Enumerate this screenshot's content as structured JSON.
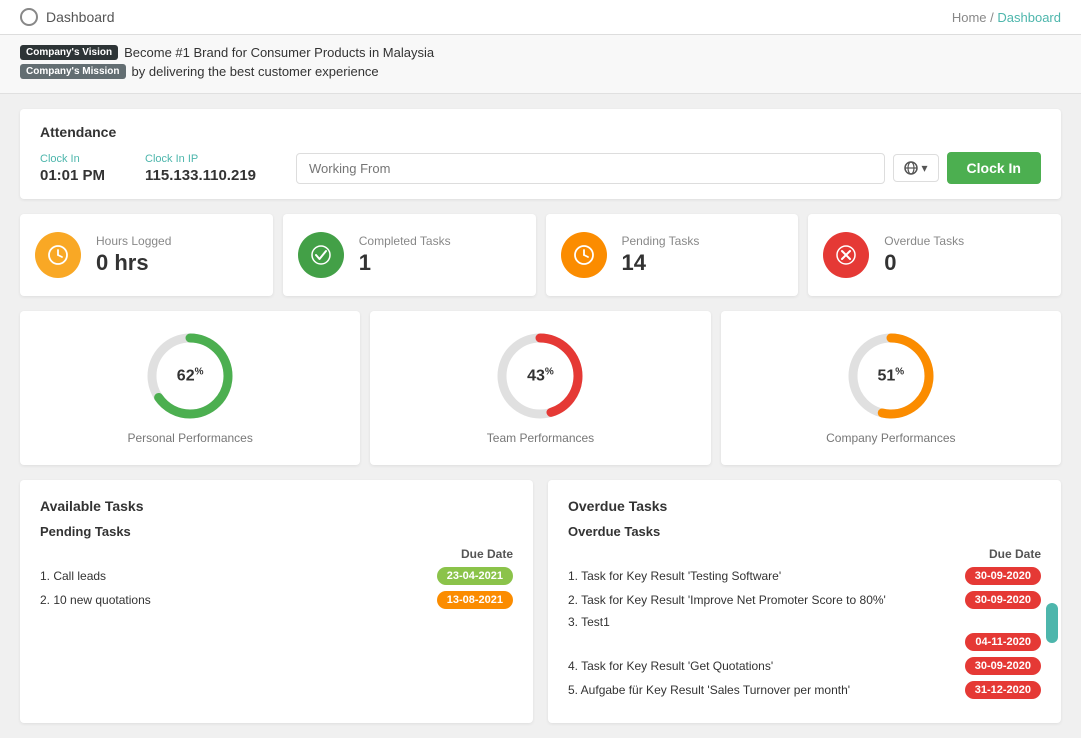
{
  "topNav": {
    "title": "Dashboard",
    "breadcrumb_home": "Home",
    "breadcrumb_separator": "/",
    "breadcrumb_current": "Dashboard"
  },
  "banner": {
    "vision_badge": "Company's Vision",
    "vision_text": "Become #1 Brand for Consumer Products in Malaysia",
    "mission_badge": "Company's Mission",
    "mission_text": "by delivering the best customer experience"
  },
  "attendance": {
    "section_title": "Attendance",
    "clock_in_label": "Clock In",
    "clock_in_value": "01:01 PM",
    "clock_in_ip_label": "Clock In IP",
    "clock_in_ip_value": "115.133.110.219",
    "working_from_placeholder": "Working From",
    "clock_in_btn": "Clock In"
  },
  "stats": [
    {
      "label": "Hours Logged",
      "value": "0 hrs",
      "icon_type": "clock",
      "color": "yellow"
    },
    {
      "label": "Completed Tasks",
      "value": "1",
      "icon_type": "check",
      "color": "green"
    },
    {
      "label": "Pending Tasks",
      "value": "14",
      "icon_type": "clock",
      "color": "orange"
    },
    {
      "label": "Overdue Tasks",
      "value": "0",
      "icon_type": "close",
      "color": "red"
    }
  ],
  "performances": [
    {
      "label": "Personal Performances",
      "percent": 62,
      "color1": "#4caf50",
      "color2": "#e0e0e0",
      "dash_green": 156,
      "dash_gray": 95
    },
    {
      "label": "Team Performances",
      "percent": 43,
      "color1": "#e53935",
      "color2": "#e0e0e0",
      "dash_green": 108,
      "dash_gray": 143
    },
    {
      "label": "Company Performances",
      "percent": 51,
      "color1": "#fb8c00",
      "color2": "#e0e0e0",
      "dash_green": 128,
      "dash_gray": 123
    }
  ],
  "available_tasks": {
    "title": "Available Tasks",
    "pending_subtitle": "Pending Tasks",
    "due_date_header": "Due Date",
    "items": [
      {
        "text": "1. Call leads",
        "due": "23-04-2021",
        "badge_class": "green-badge"
      },
      {
        "text": "2. 10 new quotations",
        "due": "13-08-2021",
        "badge_class": "orange-badge"
      }
    ]
  },
  "overdue_tasks": {
    "title": "Overdue Tasks",
    "subtitle": "Overdue Tasks",
    "due_date_header": "Due Date",
    "items": [
      {
        "text": "1. Task for Key Result 'Testing Software'",
        "due": "30-09-2020"
      },
      {
        "text": "2. Task for Key Result 'Improve Net Promoter Score to 80%'",
        "due": "30-09-2020"
      },
      {
        "text": "3. Test1",
        "due": "04-11-2020"
      },
      {
        "text": "4. Task for Key Result 'Get Quotations'",
        "due": "30-09-2020"
      },
      {
        "text": "5. Aufgabe für Key Result 'Sales Turnover per month'",
        "due": "31-12-2020"
      }
    ]
  }
}
